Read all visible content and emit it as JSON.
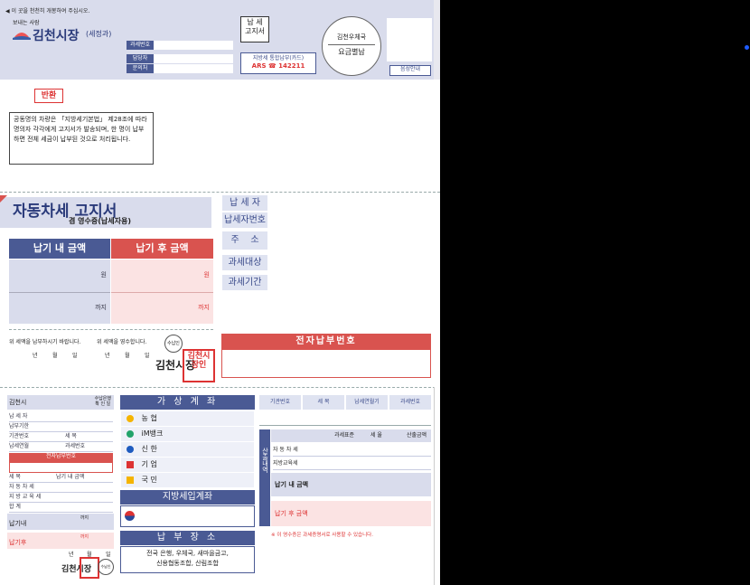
{
  "header": {
    "notice": "◀ 이 곳을 천천히 개봉하여 주십시오.",
    "sender_label": "보내는 사람",
    "city": "김천시장",
    "dept": "(세정과)",
    "fields": [
      "과세번호",
      "담당자",
      "문의처"
    ],
    "notice_type": "납 세\n고지서",
    "payment_method": "지방세 통합납부(카드)",
    "ars": "ARS ☎ 142211",
    "postoffice": "김천우체국",
    "postage": "요금별납",
    "audio_guide": "음성안내"
  },
  "return_box": {
    "title": "반환",
    "text": "공동명의 차량은 「지방세기본법」 제28조에 따라 명의자 각각에게 고지서가 발송되며, 한 명이 납부하면 전체 세금이 납부된 것으로 처리됩니다."
  },
  "main": {
    "title": "자동차세 고지서",
    "subtitle": "겸 영수증(납세자용)",
    "before_due": "납기 내 금액",
    "after_due": "납기 후 금액",
    "won": "원",
    "until": "까지",
    "pay_request": "위 세액을 납부하시기 바랍니다.",
    "received": "위 세액을 영수합니다.",
    "date_labels": [
      "년",
      "월",
      "일"
    ],
    "receipt_stamp_label": "수납인",
    "city_sign": "김천시장",
    "seal_text": "김천시장인",
    "epay_title": "전자납부번호"
  },
  "taxpayer_labels": [
    "납 세 자",
    "납세자번호",
    "주    소",
    "과세대상",
    "과세기간"
  ],
  "stub": {
    "city": "김천시",
    "bank_stamp": "수납은행\n확 인 일",
    "rows": [
      "납 세 자",
      "납부기한",
      "기관번호",
      "납세연월"
    ],
    "tax_item": "세     목",
    "tax_year": "과세번호",
    "epay": "전자납부번호",
    "item_col": "세     목",
    "amount_col": "납기 내 금액",
    "items": [
      "자 동 차 세",
      "지 방 교 육 세",
      "합      계"
    ],
    "in_due": "납기내",
    "after_due": "납기후",
    "until": "까지",
    "date_labels": [
      "년",
      "월",
      "일"
    ],
    "sign": "김천시장",
    "stamp_label": "수납인"
  },
  "virtual_account": {
    "title": "가 상 계 좌",
    "banks": [
      {
        "icon": "nh-icon",
        "name": "농 협"
      },
      {
        "icon": "im-icon",
        "name": "iM뱅크"
      },
      {
        "icon": "shinhan-icon",
        "name": "신 한"
      },
      {
        "icon": "ibk-icon",
        "name": "기 업"
      },
      {
        "icon": "kb-icon",
        "name": "국 민"
      }
    ],
    "local_tax_title": "지방세입계좌",
    "pay_place_title": "납 부 장 소",
    "pay_places": "전국 은행, 우체국, 새마을금고,\n신용협동조합, 산림조합"
  },
  "right_table": {
    "headers": [
      "기관번호",
      "세 목",
      "납세연월기",
      "과세번호"
    ],
    "calc_title": "산출내역",
    "calc_headers": [
      "과세표준",
      "세 율",
      "산출금액"
    ],
    "calc_rows": [
      "자 동 차 세",
      "지방교육세"
    ],
    "in_due": "납기 내 금액",
    "after_due": "납기 후 금액",
    "note": "※ 이 영수증은 과세증명서로 사용할 수 있습니다."
  },
  "colors": {
    "navy": "#4a5a94",
    "red": "#d9534f",
    "lavender": "#d9dcec"
  }
}
